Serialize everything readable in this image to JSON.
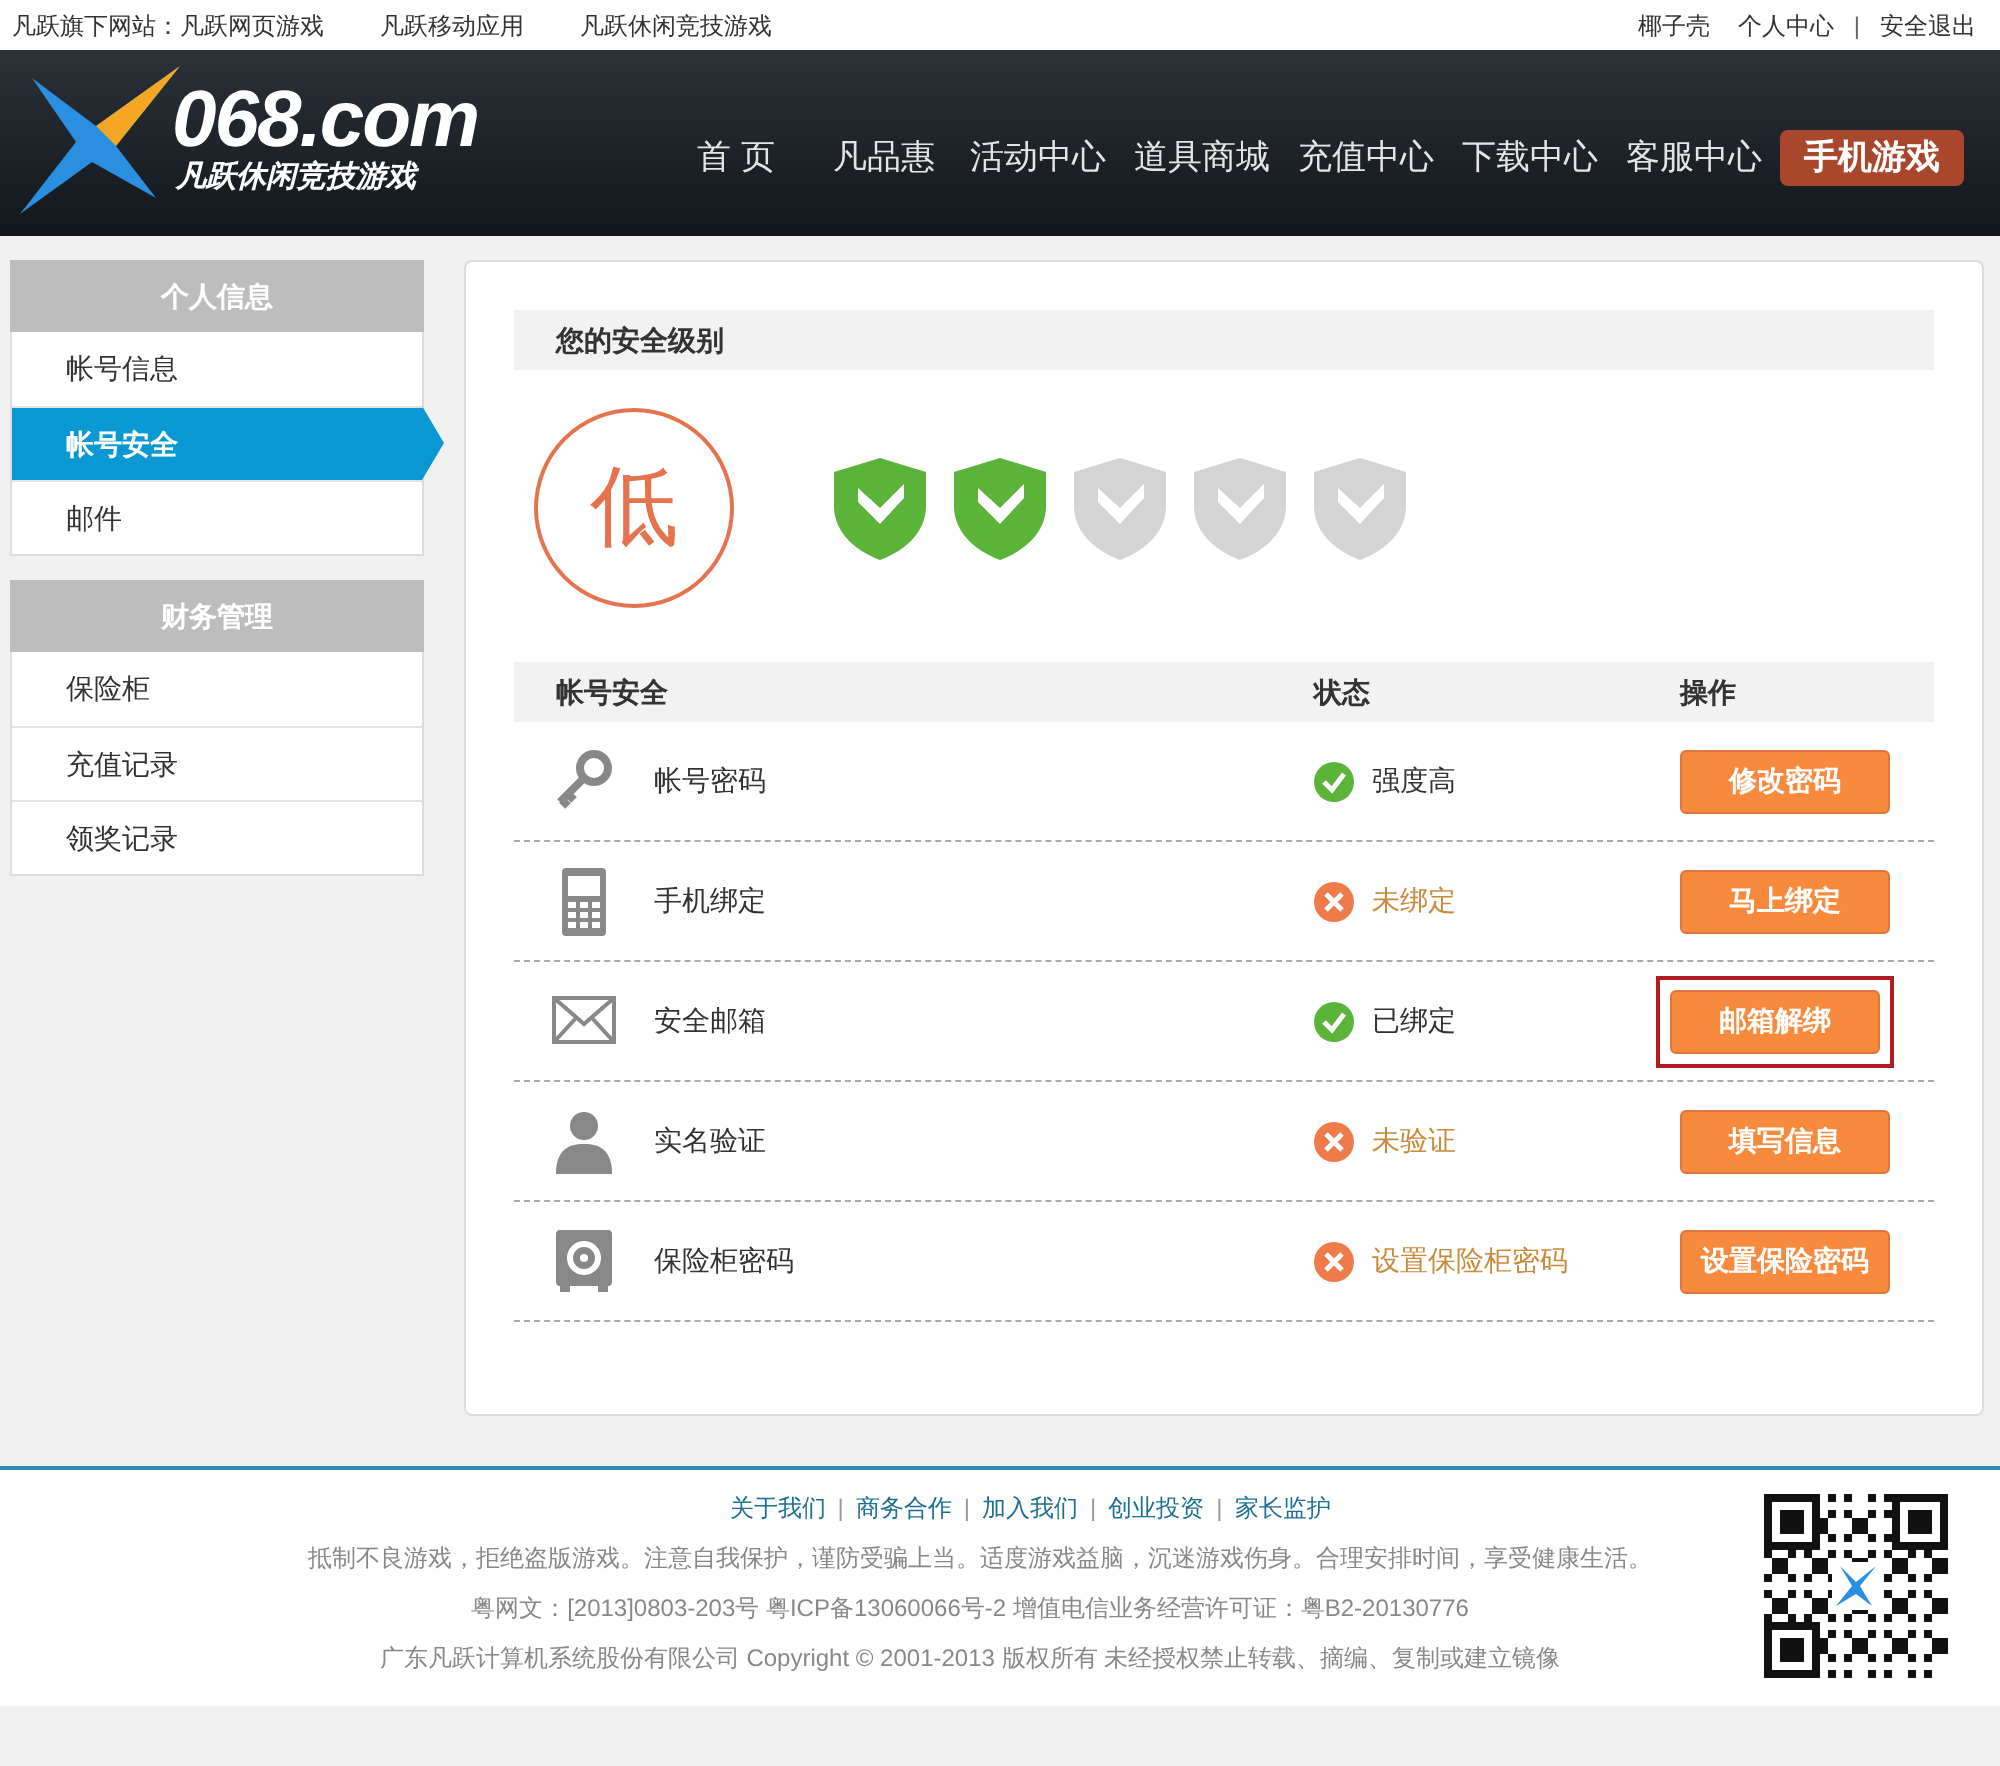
{
  "top_bar": {
    "sites_label": "凡跃旗下网站：",
    "sites": [
      "凡跃网页游戏",
      "凡跃移动应用",
      "凡跃休闲竞技游戏"
    ],
    "user": "椰子壳",
    "links": [
      "个人中心",
      "安全退出"
    ],
    "separator": "|"
  },
  "header": {
    "logo_text": "068.com",
    "logo_slogan": "凡跃休闲竞技游戏",
    "nav": [
      {
        "label": "首 页",
        "highlight": false
      },
      {
        "label": "凡品惠",
        "highlight": false
      },
      {
        "label": "活动中心",
        "highlight": false
      },
      {
        "label": "道具商城",
        "highlight": false
      },
      {
        "label": "充值中心",
        "highlight": false
      },
      {
        "label": "下载中心",
        "highlight": false
      },
      {
        "label": "客服中心",
        "highlight": false
      },
      {
        "label": "手机游戏",
        "highlight": true
      }
    ]
  },
  "sidebar": [
    {
      "title": "个人信息",
      "items": [
        {
          "label": "帐号信息",
          "selected": false
        },
        {
          "label": "帐号安全",
          "selected": true
        },
        {
          "label": "邮件",
          "selected": false
        }
      ]
    },
    {
      "title": "财务管理",
      "items": [
        {
          "label": "保险柜",
          "selected": false
        },
        {
          "label": "充值记录",
          "selected": false
        },
        {
          "label": "领奖记录",
          "selected": false
        }
      ]
    }
  ],
  "security_level": {
    "heading": "您的安全级别",
    "grade": "低",
    "shields": [
      {
        "filled": true
      },
      {
        "filled": true
      },
      {
        "filled": false
      },
      {
        "filled": false
      },
      {
        "filled": false
      }
    ]
  },
  "table": {
    "columns": [
      "帐号安全",
      "状态",
      "操作"
    ],
    "rows": [
      {
        "kind": "key",
        "name": "帐号密码",
        "ok": true,
        "status": "强度高",
        "action": "修改密码",
        "highlighted": false
      },
      {
        "kind": "phone",
        "name": "手机绑定",
        "ok": false,
        "status": "未绑定",
        "action": "马上绑定",
        "highlighted": false
      },
      {
        "kind": "mail",
        "name": "安全邮箱",
        "ok": true,
        "status": "已绑定",
        "action": "邮箱解绑",
        "highlighted": true
      },
      {
        "kind": "person",
        "name": "实名验证",
        "ok": false,
        "status": "未验证",
        "action": "填写信息",
        "highlighted": false
      },
      {
        "kind": "safe",
        "name": "保险柜密码",
        "ok": false,
        "status": "设置保险柜密码",
        "action": "设置保险密码",
        "highlighted": false
      }
    ]
  },
  "footer": {
    "links": [
      "关于我们",
      "商务合作",
      "加入我们",
      "创业投资",
      "家长监护"
    ],
    "separator": "|",
    "lines": [
      "抵制不良游戏，拒绝盗版游戏。注意自我保护，谨防受骗上当。适度游戏益脑，沉迷游戏伤身。合理安排时间，享受健康生活。",
      "粤网文：[2013]0803-203号  粤ICP备13060066号-2  增值电信业务经营许可证：粤B2-20130776",
      "广东凡跃计算机系统股份有限公司 Copyright © 2001-2013 版权所有 未经授权禁止转载、摘编、复制或建立镜像"
    ]
  }
}
